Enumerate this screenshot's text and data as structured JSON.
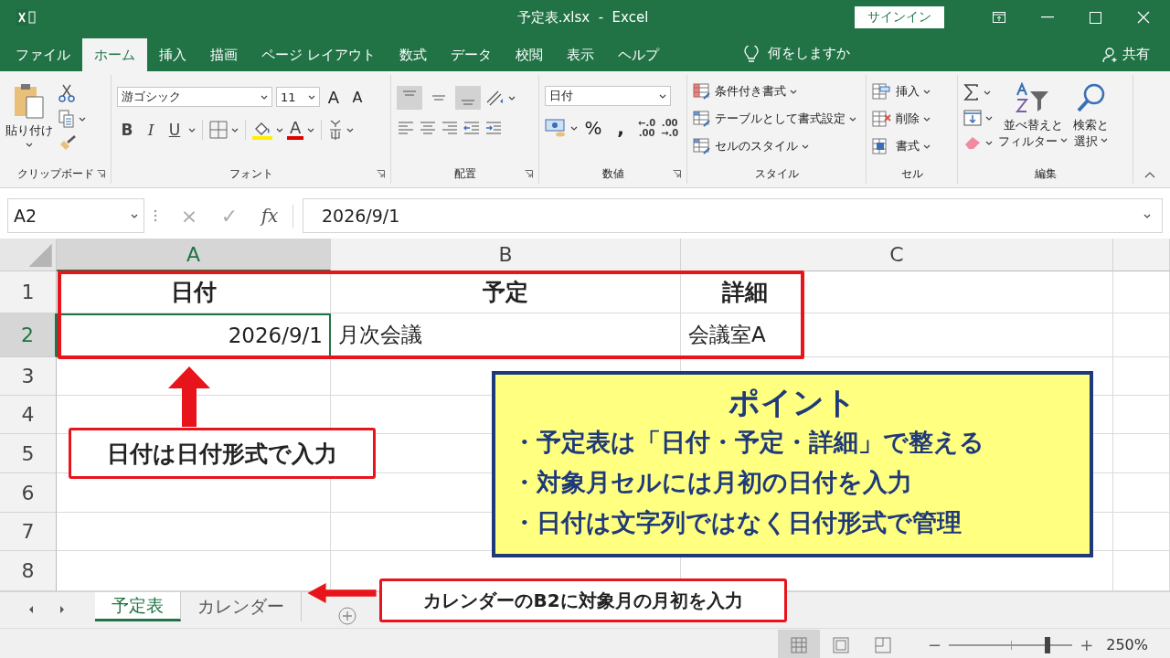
{
  "window": {
    "title": "予定表.xlsx  -  Excel",
    "sign_in": "サインイン"
  },
  "menu_tabs": [
    {
      "label": "ファイル",
      "selected": false
    },
    {
      "label": "ホーム",
      "selected": true
    },
    {
      "label": "挿入",
      "selected": false
    },
    {
      "label": "描画",
      "selected": false
    },
    {
      "label": "ページ レイアウト",
      "selected": false
    },
    {
      "label": "数式",
      "selected": false
    },
    {
      "label": "データ",
      "selected": false
    },
    {
      "label": "校閲",
      "selected": false
    },
    {
      "label": "表示",
      "selected": false
    },
    {
      "label": "ヘルプ",
      "selected": false
    }
  ],
  "tell_me": "何をしますか",
  "share": "共有",
  "ribbon": {
    "clipboard": {
      "paste": "貼り付け",
      "label": "クリップボード"
    },
    "font": {
      "name": "游ゴシック",
      "size": "11",
      "grow": "A",
      "shrink": "A",
      "styles": [
        "B",
        "I",
        "U"
      ],
      "font_color": "A",
      "label": "フォント"
    },
    "alignment": {
      "vertical": [
        {
          "selected": true
        },
        {
          "selected": false
        },
        {
          "selected": true
        }
      ],
      "label": "配置"
    },
    "number": {
      "format": "日付",
      "percent": "%",
      "comma": ",",
      "decimals": [
        {
          "top": "←.0",
          "bottom": ".00"
        },
        {
          "top": ".00",
          "bottom": "→.0"
        }
      ],
      "label": "数値"
    },
    "styles": {
      "items": [
        "条件付き書式",
        "テーブルとして書式設定",
        "セルのスタイル"
      ],
      "label": "スタイル"
    },
    "cells": {
      "items": [
        "挿入",
        "削除",
        "書式"
      ],
      "label": "セル"
    },
    "editing": {
      "sort": [
        "並べ替えと",
        "フィルター"
      ],
      "find": [
        "検索と",
        "選択"
      ],
      "label": "編集"
    }
  },
  "formula_bar": {
    "name_box": "A2",
    "cancel": "×",
    "enter": "✓",
    "fx": "fx",
    "formula": "2026/9/1"
  },
  "sheet": {
    "columns": [
      {
        "label": "A",
        "selected": true
      },
      {
        "label": "B",
        "selected": false
      },
      {
        "label": "C",
        "selected": false
      }
    ],
    "rows": [
      {
        "label": "1",
        "selected": false,
        "cells": [
          {
            "text": "日付",
            "kind": "header"
          },
          {
            "text": "予定",
            "kind": "header"
          },
          {
            "text": "詳細",
            "kind": "header"
          }
        ]
      },
      {
        "label": "2",
        "selected": true,
        "cells": [
          {
            "text": "2026/9/1",
            "kind": "date",
            "selected": true
          },
          {
            "text": "月次会議",
            "kind": "text"
          },
          {
            "text": "会議室A",
            "kind": "text"
          }
        ]
      },
      {
        "label": "3",
        "selected": false,
        "cells": []
      },
      {
        "label": "4",
        "selected": false,
        "cells": []
      },
      {
        "label": "5",
        "selected": false,
        "cells": []
      },
      {
        "label": "6",
        "selected": false,
        "cells": []
      },
      {
        "label": "7",
        "selected": false,
        "cells": []
      },
      {
        "label": "8",
        "selected": false,
        "cells": []
      }
    ]
  },
  "annotations": {
    "callout": "日付は日付形式で入力",
    "point": {
      "title": "ポイント",
      "bullets": [
        "・予定表は「日付・予定・詳細」で整える",
        "・対象月セルには月初の日付を入力",
        "・日付は文字列ではなく日付形式で管理"
      ]
    },
    "tab_callout": "カレンダーのB2に対象月の月初を入力"
  },
  "sheet_tabs": [
    {
      "label": "予定表",
      "selected": true
    },
    {
      "label": "カレンダー",
      "selected": false
    }
  ],
  "status_bar": {
    "views": [
      {
        "selected": true
      },
      {
        "selected": false
      },
      {
        "selected": false
      }
    ],
    "zoom_out": "−",
    "zoom_in": "+",
    "zoom": {
      "level": 0.8,
      "reading": "250%"
    }
  }
}
